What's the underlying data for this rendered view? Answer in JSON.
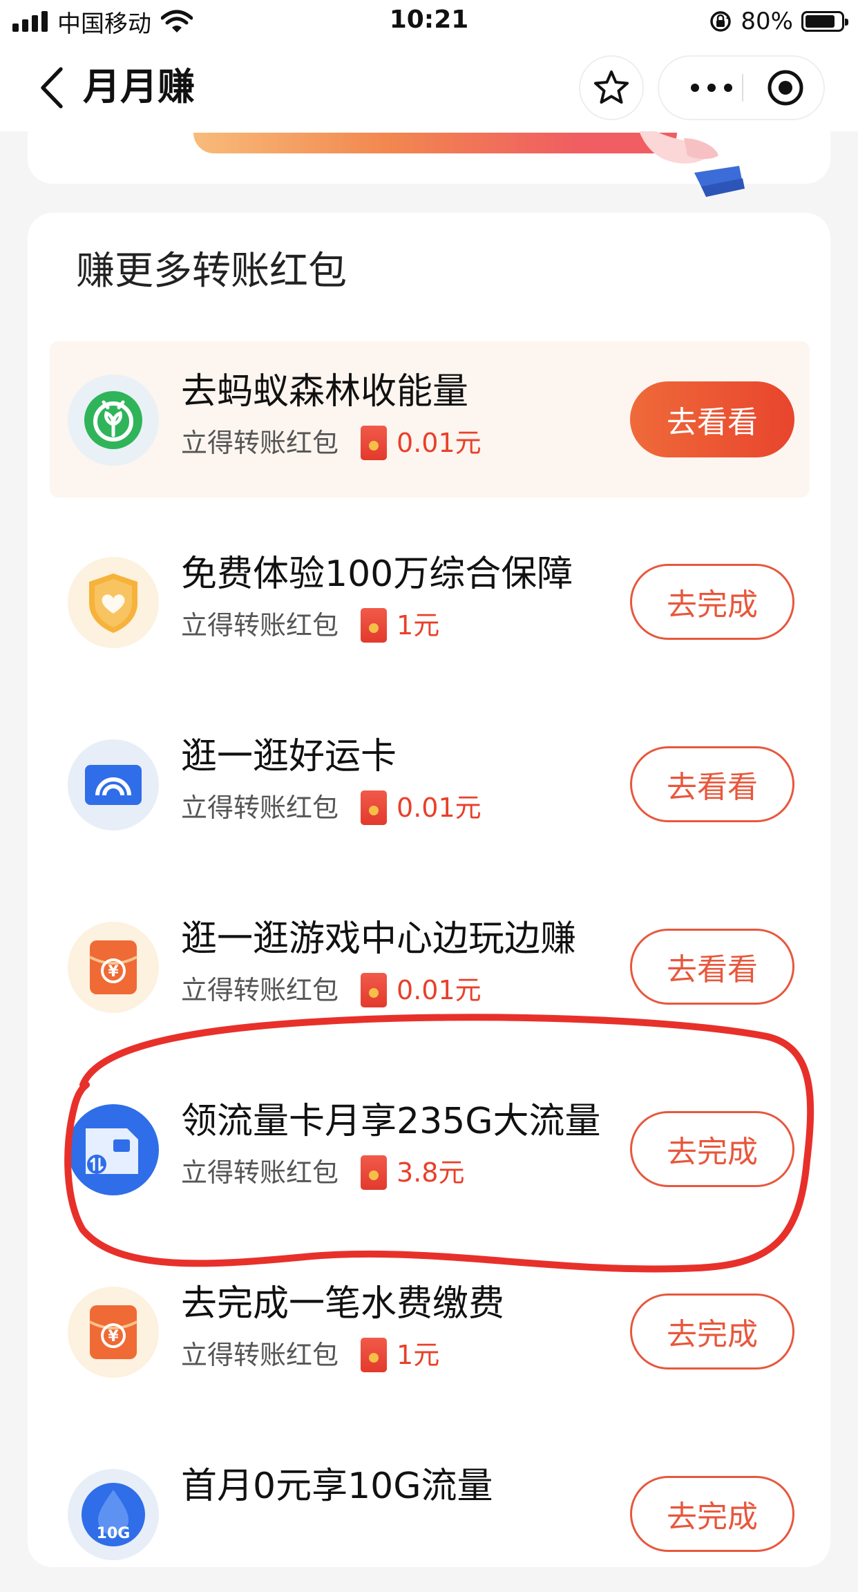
{
  "status_bar": {
    "carrier": "中国移动",
    "time": "10:21",
    "battery_percent": "80%",
    "battery_level": 0.8
  },
  "nav": {
    "title": "月月赚",
    "icons": [
      "chevron-left-icon",
      "star-icon",
      "more-icon",
      "target-icon"
    ]
  },
  "section": {
    "title": "赚更多转账红包"
  },
  "tasks": [
    {
      "title": "去蚂蚁森林收能量",
      "sub": "立得转账红包",
      "amount": "0.01元",
      "button": "去看看",
      "icon": "forest-icon",
      "highlighted": true
    },
    {
      "title": "免费体验100万综合保障",
      "sub": "立得转账红包",
      "amount": "1元",
      "button": "去完成",
      "icon": "shield-heart-icon",
      "highlighted": false
    },
    {
      "title": "逛一逛好运卡",
      "sub": "立得转账红包",
      "amount": "0.01元",
      "button": "去看看",
      "icon": "rainbow-card-icon",
      "highlighted": false
    },
    {
      "title": "逛一逛游戏中心边玩边赚",
      "sub": "立得转账红包",
      "amount": "0.01元",
      "button": "去看看",
      "icon": "yuan-envelope-icon",
      "highlighted": false
    },
    {
      "title": "领流量卡月享235G大流量",
      "sub": "立得转账红包",
      "amount": "3.8元",
      "button": "去完成",
      "icon": "sim-card-icon",
      "highlighted": false
    },
    {
      "title": "去完成一笔水费缴费",
      "sub": "立得转账红包",
      "amount": "1元",
      "button": "去完成",
      "icon": "yuan-envelope-icon",
      "highlighted": false
    },
    {
      "title": "首月0元享10G流量",
      "sub": "",
      "amount": "",
      "button": "去完成",
      "icon": "data-drop-icon",
      "icon_text": "10G",
      "highlighted": false
    }
  ],
  "colors": {
    "accent": "#e8573c",
    "amount": "#e8402a",
    "annotation": "#e8302a"
  }
}
